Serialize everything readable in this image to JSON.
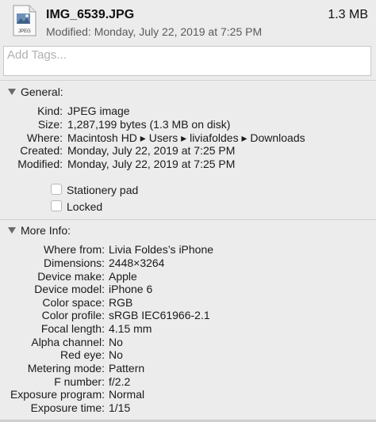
{
  "header": {
    "file_name": "IMG_6539.JPG",
    "file_size": "1.3 MB",
    "modified": "Modified: Monday, July 22, 2019 at 7:25 PM",
    "icon_label": "JPEG"
  },
  "tags": {
    "placeholder": "Add Tags..."
  },
  "general": {
    "title": "General:",
    "rows": [
      {
        "label": "Kind:",
        "value": "JPEG image"
      },
      {
        "label": "Size:",
        "value": "1,287,199 bytes (1.3 MB on disk)"
      },
      {
        "label": "Where:",
        "value": "Macintosh HD ▸ Users ▸ liviafoldes ▸ Downloads"
      },
      {
        "label": "Created:",
        "value": "Monday, July 22, 2019 at 7:25 PM"
      },
      {
        "label": "Modified:",
        "value": "Monday, July 22, 2019 at 7:25 PM"
      }
    ],
    "stationery_label": "Stationery pad",
    "locked_label": "Locked"
  },
  "more_info": {
    "title": "More Info:",
    "rows": [
      {
        "label": "Where from:",
        "value": "Livia Foldes’s iPhone"
      },
      {
        "label": "Dimensions:",
        "value": "2448×3264"
      },
      {
        "label": "Device make:",
        "value": "Apple"
      },
      {
        "label": "Device model:",
        "value": "iPhone 6"
      },
      {
        "label": "Color space:",
        "value": "RGB"
      },
      {
        "label": "Color profile:",
        "value": "sRGB IEC61966-2.1"
      },
      {
        "label": "Focal length:",
        "value": "4.15 mm"
      },
      {
        "label": "Alpha channel:",
        "value": "No"
      },
      {
        "label": "Red eye:",
        "value": "No"
      },
      {
        "label": "Metering mode:",
        "value": "Pattern"
      },
      {
        "label": "F number:",
        "value": "f/2.2"
      },
      {
        "label": "Exposure program:",
        "value": "Normal"
      },
      {
        "label": "Exposure time:",
        "value": "1/15"
      }
    ]
  }
}
